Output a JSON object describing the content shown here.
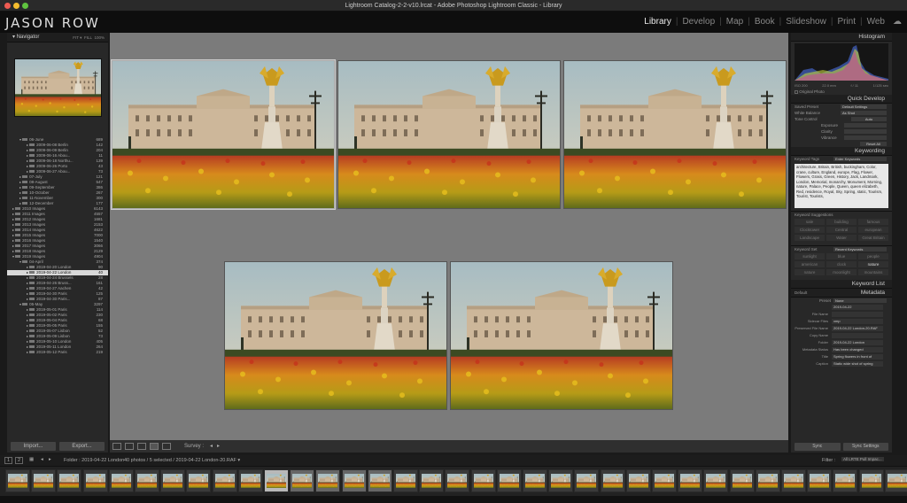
{
  "window": {
    "title": "Lightroom Catalog-2-2-v10.lrcat - Adobe Photoshop Lightroom Classic - Library"
  },
  "identity_plate": "JASON ROW",
  "modules": [
    {
      "label": "Library",
      "active": true
    },
    {
      "label": "Develop"
    },
    {
      "label": "Map"
    },
    {
      "label": "Book"
    },
    {
      "label": "Slideshow"
    },
    {
      "label": "Print"
    },
    {
      "label": "Web"
    }
  ],
  "left_panel": {
    "navigator_label": "Navigator",
    "navigator_zoom": [
      "FIT ▾",
      "FILL",
      "100%"
    ],
    "folders": [
      {
        "label": "06-June",
        "count": "689",
        "level": 2,
        "open": true
      },
      {
        "label": "2009-06-08 Berlin",
        "count": "142",
        "level": 3
      },
      {
        "label": "2009-06-09 Berlin",
        "count": "204",
        "level": 3
      },
      {
        "label": "2009-06-16 Abou...",
        "count": "11",
        "level": 3
      },
      {
        "label": "2009-06-18 Northu...",
        "count": "139",
        "level": 3
      },
      {
        "label": "2009-06-26 Porto",
        "count": "43",
        "level": 3
      },
      {
        "label": "2009-06-27 Abou...",
        "count": "73",
        "level": 3
      },
      {
        "label": "07-July",
        "count": "121",
        "level": 2
      },
      {
        "label": "08-August",
        "count": "547",
        "level": 2
      },
      {
        "label": "09-September",
        "count": "386",
        "level": 2
      },
      {
        "label": "10-October",
        "count": "267",
        "level": 2
      },
      {
        "label": "11-November",
        "count": "300",
        "level": 2
      },
      {
        "label": "12-December",
        "count": "177",
        "level": 2
      },
      {
        "label": "2010 Images",
        "count": "6143",
        "level": 1
      },
      {
        "label": "2011 Images",
        "count": "4557",
        "level": 1
      },
      {
        "label": "2012 Images",
        "count": "1681",
        "level": 1
      },
      {
        "label": "2013 Images",
        "count": "2153",
        "level": 1
      },
      {
        "label": "2014 Images",
        "count": "4622",
        "level": 1
      },
      {
        "label": "2015 Images",
        "count": "7000",
        "level": 1
      },
      {
        "label": "2016 Images",
        "count": "1540",
        "level": 1
      },
      {
        "label": "2017 Images",
        "count": "3066",
        "level": 1
      },
      {
        "label": "2018 Images",
        "count": "2129",
        "level": 1
      },
      {
        "label": "2019 Images",
        "count": "4904",
        "level": 1,
        "open": true
      },
      {
        "label": "04-April",
        "count": "374",
        "level": 2,
        "open": true
      },
      {
        "label": "2019-04-20 London",
        "count": "90",
        "level": 3
      },
      {
        "label": "2019-04-22 London",
        "count": "40",
        "level": 3,
        "selected": true
      },
      {
        "label": "2019-04-24 Brussels",
        "count": "28",
        "level": 3
      },
      {
        "label": "2019-04-26 Bruss...",
        "count": "161",
        "level": 3
      },
      {
        "label": "2019-04-27 Aachen",
        "count": "42",
        "level": 3
      },
      {
        "label": "2019-04-30 Paris",
        "count": "125",
        "level": 3
      },
      {
        "label": "2019-04-30 Paris...",
        "count": "87",
        "level": 3
      },
      {
        "label": "05-May",
        "count": "3297",
        "level": 2,
        "open": true
      },
      {
        "label": "2019-05-01 Paris",
        "count": "114",
        "level": 3
      },
      {
        "label": "2019-05-02 Paris",
        "count": "230",
        "level": 3
      },
      {
        "label": "2019-05-04 Paris",
        "count": "68",
        "level": 3
      },
      {
        "label": "2019-05-05 Paris",
        "count": "155",
        "level": 3
      },
      {
        "label": "2019-05-07 Lisbon",
        "count": "52",
        "level": 3
      },
      {
        "label": "2019-05-09 Lisbon",
        "count": "73",
        "level": 3
      },
      {
        "label": "2019-05-10 London",
        "count": "405",
        "level": 3
      },
      {
        "label": "2019-05-11 London",
        "count": "264",
        "level": 3
      },
      {
        "label": "2019-05-12 Paris",
        "count": "219",
        "level": 3
      }
    ],
    "import_label": "Import...",
    "export_label": "Export..."
  },
  "toolbar": {
    "survey_label": "Survey :"
  },
  "right_panel": {
    "histogram_label": "Histogram",
    "hist_info": [
      "ISO 200",
      "22.0 mm",
      "f / 11",
      "1/125 sec"
    ],
    "original_photo_label": "Original Photo",
    "quick_develop_label": "Quick Develop",
    "saved_preset_label": "Saved Preset",
    "saved_preset_value": "Default Settings",
    "white_balance_label": "White Balance",
    "white_balance_value": "As Shot",
    "tone_control_label": "Tone Control",
    "auto_label": "Auto",
    "exposure_label": "Exposure",
    "clarity_label": "Clarity",
    "vibrance_label": "Vibrance",
    "reset_all_label": "Reset All",
    "keywording_label": "Keywording",
    "keyword_tags_label": "Keyword Tags",
    "keyword_tags_value": "Enter Keywords",
    "keywords_text": "architecture, Britain, British, buckingham, Color, crane, culture, England, europe, Flag, Flower, Flowers, Grass, Green, History, Jack, Landmark, London, Memorial, monarchy, Monument, Morning, nature, Palace, People, Queen, queen elizabeth, Red, residence, Royal, Sky, Spring, static, Tourism, Tourist, Tourists,",
    "keyword_suggestions_label": "Keyword Suggestions",
    "suggestions": [
      "sale",
      "building",
      "famous",
      "Clocktower",
      "Central",
      "european",
      "Landscape",
      "Water",
      "Great Britain"
    ],
    "keyword_set_label": "Keyword Set",
    "keyword_set_value": "Recent Keywords",
    "keyword_set": [
      "sunlight",
      "blue",
      "people",
      "american",
      "clock",
      "nature",
      "nature",
      "moonlight",
      "mountains"
    ],
    "keyword_list_label": "Keyword List",
    "metadata_label": "Metadata",
    "metadata_preset_value": "Default",
    "preset_label": "Preset",
    "preset_value": "None",
    "metadata_rows": [
      {
        "label": "",
        "value": "2019-04-22"
      },
      {
        "label": "File Name",
        "value": ""
      },
      {
        "label": "Sidecar Files",
        "value": "xmp"
      },
      {
        "label": "Preserved File Name",
        "value": "2019-04-22 London-20.RAF"
      },
      {
        "label": "Copy Name",
        "value": ""
      },
      {
        "label": "Folder",
        "value": "2019-04-22 London"
      },
      {
        "label": "Metadata Status",
        "value": "Has been changed"
      },
      {
        "label": "Title",
        "value": "Spring flowers in front of"
      },
      {
        "label": "Caption",
        "value": "Static wide shot of spring"
      }
    ],
    "sync_label": "Sync",
    "sync_settings_label": "Sync Settings"
  },
  "filmbar": {
    "pages": [
      "1",
      "2"
    ],
    "folder_text": "Folder : 2019-04-22 London",
    "count_text": "40 photos / 5 selected / 2019-04-22 London-20.RAF ▾",
    "filter_label": "Filter :",
    "filter_value": "All LRTE Pull Impac..."
  },
  "colors": {
    "panel": "#282828",
    "center": "#7b7b7b",
    "header": "#0e0e0e",
    "accent": "#4a8ed8"
  }
}
